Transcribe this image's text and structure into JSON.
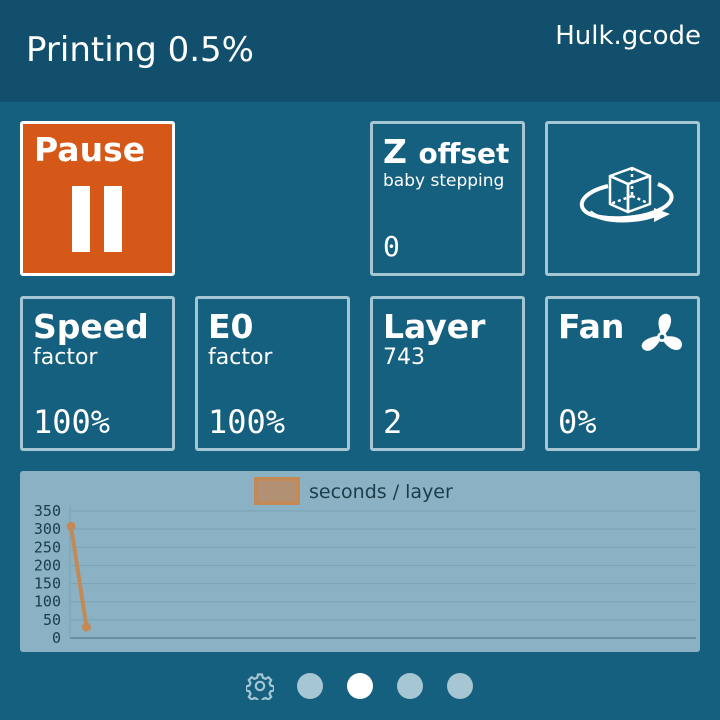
{
  "header": {
    "status": "Printing 0.5%",
    "file": "Hulk.gcode"
  },
  "tiles": {
    "pause": {
      "label": "Pause",
      "icon": "pause-icon"
    },
    "z_offset": {
      "title": "Z",
      "title_suffix": "offset",
      "subtitle": "baby stepping",
      "value": "0"
    },
    "rotate": {
      "icon": "rotate-cube-icon"
    },
    "speed": {
      "title": "Speed",
      "subtitle": "factor",
      "value": "100%"
    },
    "e0": {
      "title": "E0",
      "subtitle": "factor",
      "value": "100%"
    },
    "layer": {
      "title": "Layer",
      "subtitle": "743",
      "value": "2"
    },
    "fan": {
      "title": "Fan",
      "value": "0%",
      "icon": "fan-icon"
    }
  },
  "pager": {
    "settings_icon": "gear-icon",
    "page_count": 4,
    "active_page": 2
  },
  "colors": {
    "background": "#15607f",
    "header": "#114f6c",
    "pause_tile": "#d55818",
    "tile_border": "#a7c6d3",
    "chart_bg": "#8ab2c4",
    "series": "#c38a58"
  },
  "chart_data": {
    "type": "line",
    "legend": "seconds / layer",
    "series": [
      {
        "name": "seconds / layer",
        "x": [
          1,
          2
        ],
        "values": [
          308,
          30
        ]
      }
    ],
    "yticks": [
      0,
      50,
      100,
      150,
      200,
      250,
      300,
      350
    ],
    "ylim": [
      0,
      350
    ],
    "grid": true,
    "legend_position": "top-center"
  }
}
